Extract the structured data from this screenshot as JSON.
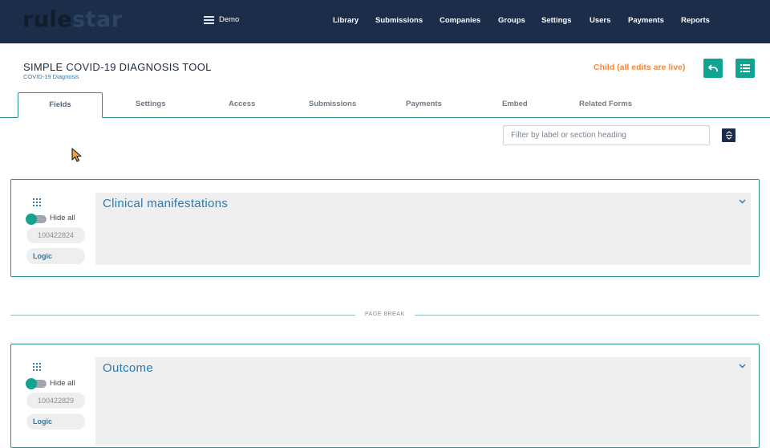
{
  "navbar": {
    "logo_part1": "rule",
    "logo_part2": "star",
    "company": "Demo",
    "items": [
      "Library",
      "Submissions",
      "Companies",
      "Groups",
      "Settings",
      "Users",
      "Payments",
      "Reports"
    ]
  },
  "header": {
    "title": "SIMPLE COVID-19 DIAGNOSIS TOOL",
    "subtitle": "COVID-19 Diagnosis",
    "status": "Child (all edits are live)"
  },
  "tabs": [
    "Fields",
    "Settings",
    "Access",
    "Submissions",
    "Payments",
    "Embed",
    "Related Forms"
  ],
  "active_tab": "Fields",
  "filter": {
    "placeholder": "Filter by label or section heading",
    "value": ""
  },
  "sections": [
    {
      "title": "Clinical manifestations",
      "id": "100422824",
      "hide_all_label": "Hide all",
      "logic_label": "Logic",
      "hide_all_on": false
    },
    {
      "title": "Outcome",
      "id": "100422829",
      "hide_all_label": "Hide all",
      "logic_label": "Logic",
      "hide_all_on": false
    }
  ],
  "page_break_label": "PAGE BREAK",
  "colors": {
    "navbar": "#1b2d48",
    "accent_teal": "#10a591",
    "status_orange": "#f0883b",
    "link_blue": "#2b79b2"
  },
  "icons": {
    "company": "building-icon",
    "revert": "undo-icon",
    "menu": "list-icon",
    "collapse": "collapse-expand-icon",
    "drag": "drag-handle-icon",
    "section_toggle": "chevron-down-icon"
  }
}
